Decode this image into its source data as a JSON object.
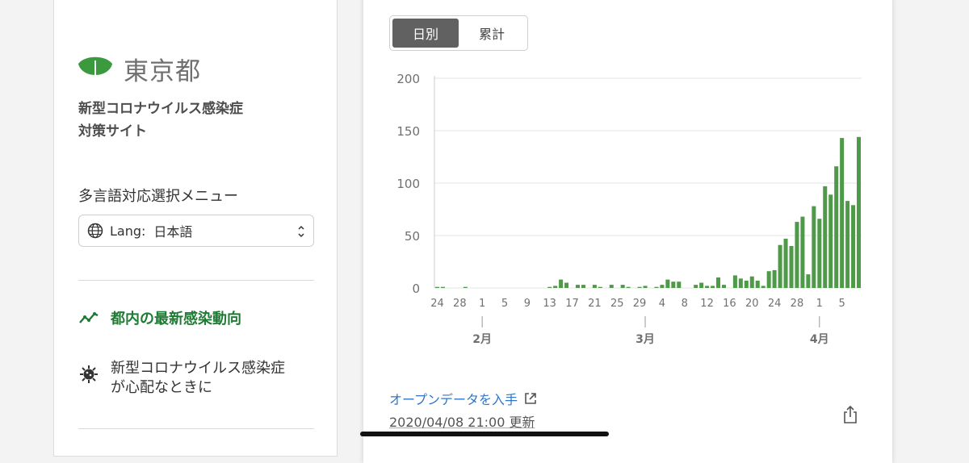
{
  "sidebar": {
    "logo_text": "東京都",
    "site_title_line1": "新型コロナウイルス感染症",
    "site_title_line2": "対策サイト",
    "lang_menu_title": "多言語対応選択メニュー",
    "lang_label": "Lang:",
    "lang_value": "日本語",
    "nav_active": "都内の最新感染動向",
    "nav_item_line1": "新型コロナウイルス感染症",
    "nav_item_line2": "が心配なときに"
  },
  "panel": {
    "toggle_daily": "日別",
    "toggle_cumulative": "累計",
    "open_data_link": "オープンデータを入手",
    "updated": "2020/04/08 21:00 更新"
  },
  "colors": {
    "bar": "#4e9a48",
    "active_nav": "#1f7a34",
    "link": "#2f76c8"
  },
  "chart_data": {
    "type": "bar",
    "ylim": [
      0,
      200
    ],
    "y_ticks": [
      "0",
      "50",
      "100",
      "150",
      "200"
    ],
    "x_tick_labels": [
      "24",
      "28",
      "1",
      "5",
      "9",
      "13",
      "17",
      "21",
      "25",
      "29",
      "4",
      "8",
      "12",
      "16",
      "20",
      "24",
      "28",
      "1",
      "5"
    ],
    "month_labels": [
      "2月",
      "3月",
      "4月"
    ],
    "grid": true,
    "dates": [
      "1/24",
      "1/25",
      "1/26",
      "1/27",
      "1/28",
      "1/29",
      "1/30",
      "1/31",
      "2/1",
      "2/2",
      "2/3",
      "2/4",
      "2/5",
      "2/6",
      "2/7",
      "2/8",
      "2/9",
      "2/10",
      "2/11",
      "2/12",
      "2/13",
      "2/14",
      "2/15",
      "2/16",
      "2/17",
      "2/18",
      "2/19",
      "2/20",
      "2/21",
      "2/22",
      "2/23",
      "2/24",
      "2/25",
      "2/26",
      "2/27",
      "2/28",
      "2/29",
      "3/1",
      "3/2",
      "3/3",
      "3/4",
      "3/5",
      "3/6",
      "3/7",
      "3/8",
      "3/9",
      "3/10",
      "3/11",
      "3/12",
      "3/13",
      "3/14",
      "3/15",
      "3/16",
      "3/17",
      "3/18",
      "3/19",
      "3/20",
      "3/21",
      "3/22",
      "3/23",
      "3/24",
      "3/25",
      "3/26",
      "3/27",
      "3/28",
      "3/29",
      "3/30",
      "3/31",
      "4/1",
      "4/2",
      "4/3",
      "4/4",
      "4/5",
      "4/6",
      "4/7",
      "4/8"
    ],
    "values": [
      1,
      1,
      0,
      0,
      0,
      1,
      0,
      0,
      0,
      0,
      0,
      0,
      0,
      0,
      0,
      0,
      0,
      0,
      0,
      0,
      1,
      2,
      8,
      5,
      0,
      3,
      3,
      0,
      3,
      1,
      0,
      3,
      0,
      3,
      1,
      0,
      1,
      2,
      0,
      1,
      3,
      8,
      6,
      6,
      0,
      0,
      3,
      5,
      2,
      2,
      10,
      3,
      0,
      12,
      9,
      7,
      11,
      7,
      2,
      16,
      17,
      41,
      47,
      40,
      63,
      68,
      13,
      78,
      66,
      97,
      89,
      116,
      143,
      83,
      79,
      144
    ]
  }
}
